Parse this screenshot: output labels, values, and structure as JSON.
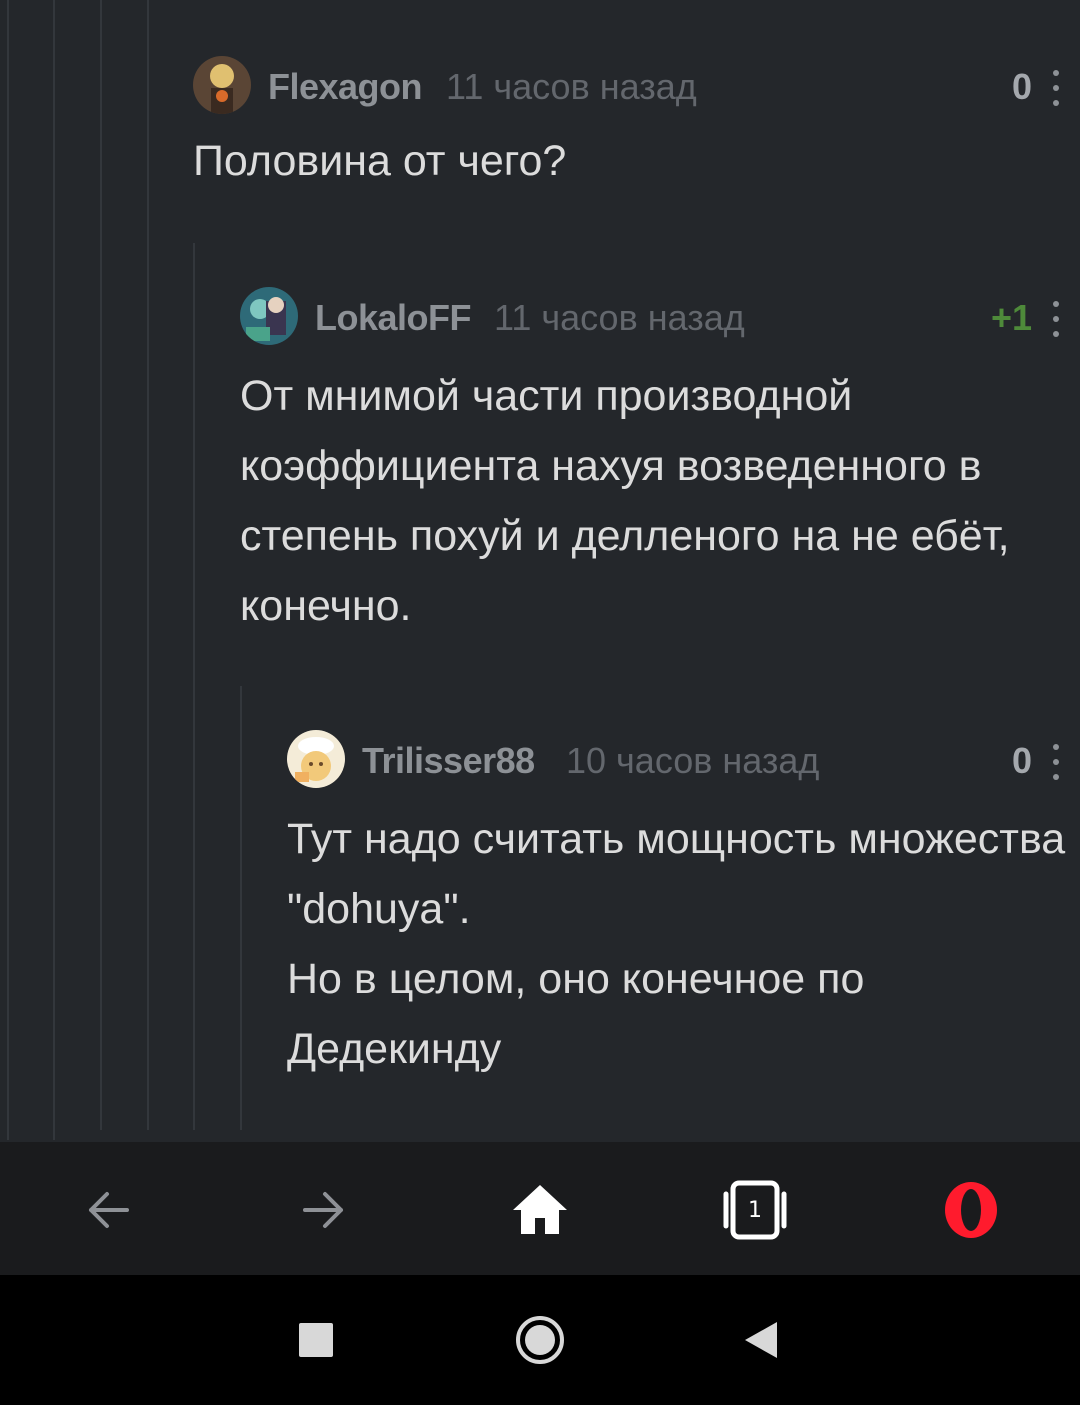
{
  "comments": [
    {
      "author": "Flexagon",
      "time": "11 часов назад",
      "rating": "0",
      "body": "Половина от чего?"
    },
    {
      "author": "LokaloFF",
      "time": "11 часов назад",
      "rating": "+1",
      "body": "От мнимой части производной коэффициента нахуя возведенного в степень похуй и делленого на не ебёт, конечно."
    },
    {
      "author": "Trilisser88",
      "time": "10 часов назад",
      "rating": "0",
      "body_lines": [
        "Тут надо считать мощность множества \"dohuya\".",
        "Но в целом, оно конечное по Дедекинду"
      ]
    }
  ],
  "browser_nav": {
    "tab_count": "1",
    "icons": [
      "back-arrow-icon",
      "forward-arrow-icon",
      "home-icon",
      "tabs-icon",
      "opera-logo-icon"
    ]
  },
  "system_nav": {
    "icons": [
      "recents-square-icon",
      "home-circle-icon",
      "back-triangle-icon"
    ]
  },
  "colors": {
    "background": "#24272b",
    "positive_rating": "#4e8a3a",
    "opera_red": "#ff1b2d"
  }
}
